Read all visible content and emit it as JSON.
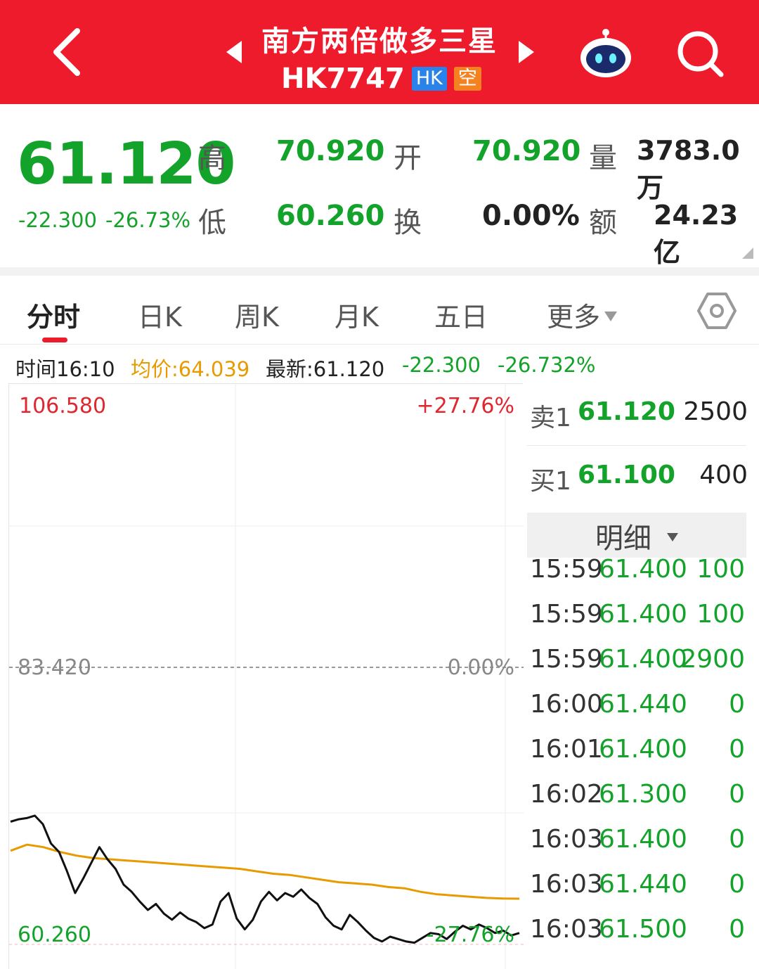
{
  "header": {
    "title": "南方两倍做多三星",
    "code": "HK7747",
    "tag_market": "HK",
    "tag_type": "空",
    "colors": {
      "bg": "#ee1b2c"
    }
  },
  "quote": {
    "price": "61.120",
    "change": "-22.300",
    "change_pct": "-26.73%",
    "high_label": "高",
    "high": "70.920",
    "open_label": "开",
    "open": "70.920",
    "volume_label": "量",
    "volume": "3783.0万",
    "low_label": "低",
    "low": "60.260",
    "turnover_label": "换",
    "turnover": "0.00%",
    "amount_label": "额",
    "amount": "24.23亿"
  },
  "tabs": [
    {
      "label": "分时",
      "active": true
    },
    {
      "label": "日K"
    },
    {
      "label": "周K"
    },
    {
      "label": "月K"
    },
    {
      "label": "五日"
    },
    {
      "label": "更多"
    }
  ],
  "info": {
    "time": "时间16:10",
    "avg": "均价:64.039",
    "latest": "最新:61.120",
    "change": "-22.300",
    "change_pct": "-26.732%"
  },
  "chart_data": {
    "type": "line",
    "y_top": "106.580",
    "y_mid": "83.420",
    "y_bottom": "60.260",
    "pct_top": "+27.76%",
    "pct_mid": "0.00%",
    "pct_bottom": "-27.76%",
    "ylim": [
      60.26,
      106.58
    ],
    "series": [
      {
        "name": "price",
        "color": "#111111",
        "values": [
          70.4,
          70.6,
          70.7,
          70.9,
          70.2,
          68.6,
          67.9,
          66.3,
          64.5,
          65.7,
          67.0,
          68.3,
          67.3,
          66.5,
          65.2,
          64.6,
          63.8,
          63.1,
          63.6,
          62.8,
          62.3,
          62.9,
          62.4,
          62.1,
          61.6,
          61.9,
          63.8,
          64.5,
          62.4,
          61.5,
          62.3,
          63.8,
          64.6,
          63.9,
          64.5,
          64.2,
          64.8,
          64.1,
          63.6,
          62.5,
          61.8,
          61.5,
          62.7,
          62.1,
          61.4,
          60.8,
          60.5,
          60.9,
          60.7,
          60.5,
          60.4,
          60.8,
          61.2,
          61.1,
          60.7,
          61.3,
          61.8,
          61.5,
          61.9,
          61.6,
          61.2,
          61.4,
          61.0,
          61.2
        ]
      },
      {
        "name": "avg",
        "color": "#e89b00",
        "values": [
          68.0,
          68.5,
          68.3,
          67.9,
          67.6,
          67.4,
          67.3,
          67.2,
          67.1,
          67.0,
          66.9,
          66.8,
          66.7,
          66.6,
          66.5,
          66.3,
          66.1,
          66.0,
          65.8,
          65.6,
          65.4,
          65.3,
          65.2,
          65.0,
          64.9,
          64.6,
          64.4,
          64.3,
          64.2,
          64.1,
          64.05,
          64.04
        ]
      }
    ]
  },
  "order_book": {
    "sell": {
      "label": "卖1",
      "price": "61.120",
      "vol": "2500"
    },
    "buy": {
      "label": "买1",
      "price": "61.100",
      "vol": "400"
    },
    "detail_label": "明细"
  },
  "ticks": [
    {
      "time": "15:59",
      "price": "61.400",
      "vol": "100"
    },
    {
      "time": "15:59",
      "price": "61.400",
      "vol": "100"
    },
    {
      "time": "15:59",
      "price": "61.400",
      "vol": "2900"
    },
    {
      "time": "16:00",
      "price": "61.440",
      "vol": "0"
    },
    {
      "time": "16:01",
      "price": "61.400",
      "vol": "0"
    },
    {
      "time": "16:02",
      "price": "61.300",
      "vol": "0"
    },
    {
      "time": "16:03",
      "price": "61.400",
      "vol": "0"
    },
    {
      "time": "16:03",
      "price": "61.440",
      "vol": "0"
    },
    {
      "time": "16:03",
      "price": "61.500",
      "vol": "0"
    }
  ]
}
